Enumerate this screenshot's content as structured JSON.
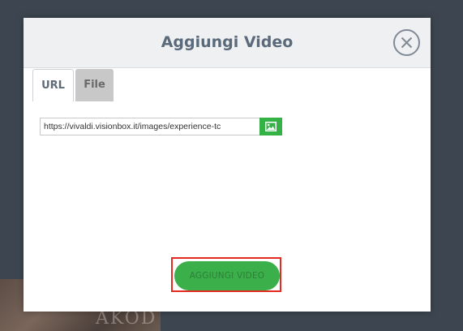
{
  "background": {
    "color": "#3d4650",
    "photo_text": "AKOD\nEON"
  },
  "modal": {
    "title": "Aggiungi Video",
    "close_icon": "close-circle-icon",
    "tabs": [
      {
        "label": "URL",
        "active": true
      },
      {
        "label": "File",
        "active": false
      }
    ],
    "url_field": {
      "value": "https://vivaldi.visionbox.it/images/experience-tc",
      "placeholder": ""
    },
    "image_picker_icon": "image-icon",
    "submit_label": "AGGIUNGI VIDEO"
  },
  "colors": {
    "accent_green": "#3bb04a",
    "highlight_red": "#e32b22",
    "title_text": "#5a6a7a"
  }
}
